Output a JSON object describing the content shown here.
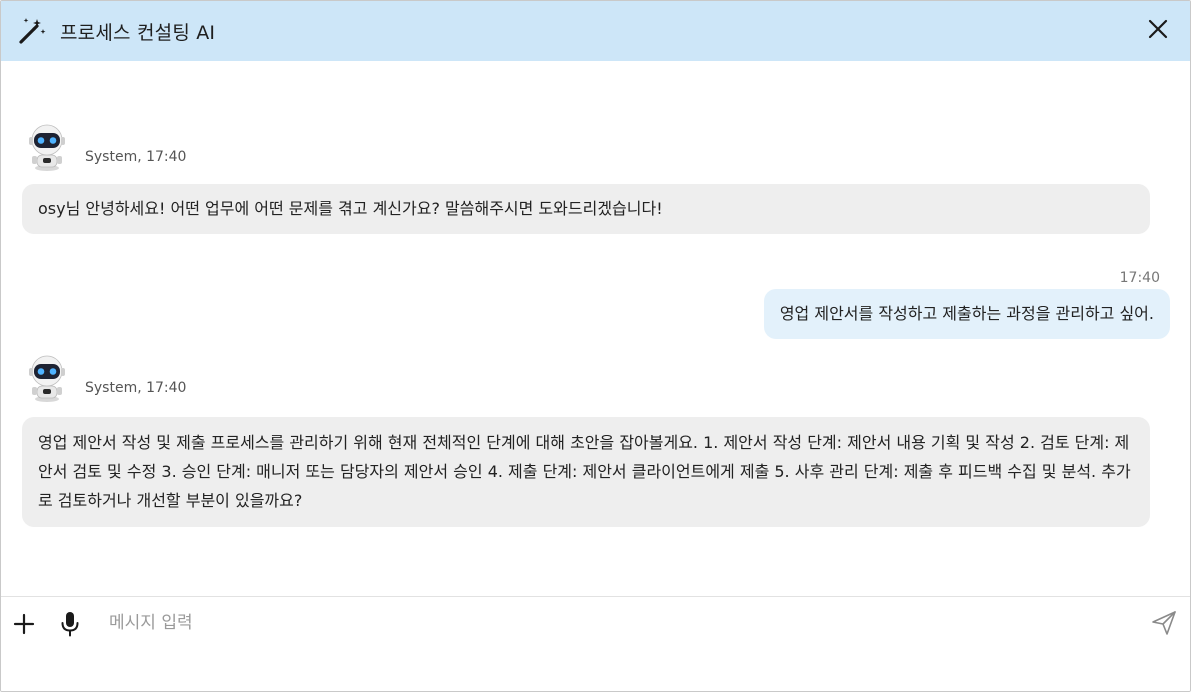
{
  "header": {
    "title": "프로세스 컨설팅 AI",
    "wand_icon": "magic-wand-icon",
    "close_icon": "close-icon",
    "background": "#cde6f8"
  },
  "messages": [
    {
      "sender": "System",
      "time": "17:40",
      "meta": "System, 17:40",
      "text": "osy님 안녕하세요! 어떤 업무에 어떤 문제를 겪고 계신가요? 말씀해주시면 도와드리겠습니다!"
    },
    {
      "sender": "user",
      "time": "17:40",
      "text": "영업 제안서를 작성하고 제출하는 과정을 관리하고 싶어."
    },
    {
      "sender": "System",
      "time": "17:40",
      "meta": "System, 17:40",
      "text": "영업 제안서 작성 및 제출 프로세스를 관리하기 위해 현재 전체적인 단계에 대해 초안을 잡아볼게요. 1. 제안서 작성 단계: 제안서 내용 기획 및 작성 2. 검토 단계: 제안서 검토 및 수정 3. 승인 단계: 매니저 또는 담당자의 제안서 승인 4. 제출 단계: 제안서 클라이언트에게 제출 5. 사후 관리 단계: 제출 후 피드백 수집 및 분석. 추가로 검토하거나 개선할 부분이 있을까요?"
    }
  ],
  "input": {
    "placeholder": "메시지 입력",
    "value": "",
    "plus_icon": "plus-icon",
    "mic_icon": "microphone-icon",
    "send_icon": "send-icon"
  },
  "colors": {
    "bot_bubble": "#eeeeee",
    "user_bubble": "#e3f1fb"
  }
}
